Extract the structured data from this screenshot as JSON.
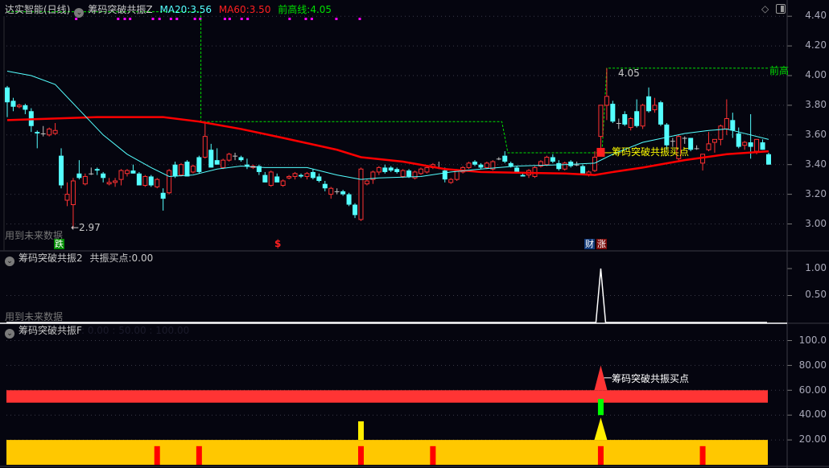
{
  "main_panel": {
    "stock_name": "达实智能(日线)",
    "indicator": "筹码突破共振Z",
    "ma20_label": "MA20:",
    "ma20_value": "3.56",
    "ma60_label": "MA60:",
    "ma60_value": "3.50",
    "prev_high_label": "前高线:",
    "prev_high_value": "4.05",
    "future_data_note": "用到未来数据",
    "low_annotation": "←2.97",
    "high_annotation": "4.05",
    "prev_high_tag": "前高",
    "buy_signal_label": "筹码突破共振买点",
    "markers": {
      "fall": "跌",
      "dollar": "$",
      "finance": "财",
      "rise": "涨"
    },
    "axis_labels": [
      "4.40",
      "4.20",
      "4.00",
      "3.80",
      "3.60",
      "3.40",
      "3.20",
      "3.00"
    ],
    "axis_values": [
      4.4,
      4.2,
      4.0,
      3.8,
      3.6,
      3.4,
      3.2,
      3.0
    ]
  },
  "panel2": {
    "indicator": "筹码突破共振2",
    "value_label": "共振买点:",
    "value": "0.00",
    "future_data_note": "用到未来数据",
    "axis_labels": [
      "1.00",
      "0.50"
    ],
    "spike_index": 99
  },
  "panel3": {
    "indicator": "筹码突破共振F",
    "hidden_values": ": 0.00 : 50.00 : 100.00",
    "buy_signal_label": "筹码突破共振买点",
    "axis_labels": [
      "100.0",
      "80.00",
      "60.00",
      "40.00",
      "20.00"
    ],
    "red_band": [
      50,
      60
    ],
    "yellow_band": [
      0,
      20
    ],
    "signal_index": 99,
    "red_spike_peak": 80,
    "yellow_spike_peak": 38,
    "green_bar": [
      40,
      53
    ],
    "yellow_bars": [
      {
        "i": 59,
        "v": 35
      }
    ],
    "red_bar_indices": [
      25,
      32,
      59,
      71,
      99,
      116
    ]
  },
  "colors": {
    "up": "#ff3232",
    "down": "#54ffff",
    "doji": "#c0c0c0",
    "ma20": "#54ffff",
    "ma60": "#ff0000",
    "prev_high": "#00e000",
    "dots": "#ff00ff",
    "signal_text": "#ffff00"
  },
  "chart_data": {
    "type": "candlestick",
    "ylim": [
      2.85,
      4.45
    ],
    "ohlc": [
      [
        3.92,
        3.93,
        3.72,
        3.82
      ],
      [
        3.83,
        3.85,
        3.76,
        3.79
      ],
      [
        3.79,
        3.81,
        3.78,
        3.8
      ],
      [
        3.8,
        3.81,
        3.74,
        3.77
      ],
      [
        3.76,
        3.78,
        3.62,
        3.66
      ],
      [
        3.62,
        3.63,
        3.51,
        3.61
      ],
      [
        3.61,
        3.66,
        3.59,
        3.61
      ],
      [
        3.6,
        3.65,
        3.59,
        3.64
      ],
      [
        3.61,
        3.68,
        3.6,
        3.63
      ],
      [
        3.46,
        3.51,
        3.24,
        3.26
      ],
      [
        3.16,
        3.28,
        3.12,
        3.2
      ],
      [
        3.13,
        3.31,
        2.97,
        3.29
      ],
      [
        3.34,
        3.43,
        3.3,
        3.31
      ],
      [
        3.27,
        3.34,
        3.26,
        3.32
      ],
      [
        3.34,
        3.38,
        3.33,
        3.34
      ],
      [
        3.37,
        3.38,
        3.33,
        3.36
      ],
      [
        3.34,
        3.35,
        3.28,
        3.31
      ],
      [
        3.27,
        3.31,
        3.26,
        3.28
      ],
      [
        3.28,
        3.31,
        3.25,
        3.29
      ],
      [
        3.3,
        3.37,
        3.26,
        3.36
      ],
      [
        3.34,
        3.37,
        3.32,
        3.36
      ],
      [
        3.36,
        3.4,
        3.34,
        3.34
      ],
      [
        3.34,
        3.35,
        3.26,
        3.26
      ],
      [
        3.26,
        3.33,
        3.25,
        3.32
      ],
      [
        3.32,
        3.33,
        3.25,
        3.26
      ],
      [
        3.25,
        3.31,
        3.24,
        3.3
      ],
      [
        3.21,
        3.24,
        3.09,
        3.17
      ],
      [
        3.21,
        3.37,
        3.2,
        3.36
      ],
      [
        3.4,
        3.42,
        3.31,
        3.32
      ],
      [
        3.33,
        3.41,
        3.32,
        3.4
      ],
      [
        3.42,
        3.43,
        3.32,
        3.32
      ],
      [
        3.35,
        3.4,
        3.34,
        3.39
      ],
      [
        3.45,
        3.46,
        3.34,
        3.35
      ],
      [
        3.45,
        3.68,
        3.44,
        3.59
      ],
      [
        3.5,
        3.54,
        3.38,
        3.38
      ],
      [
        3.43,
        3.51,
        3.4,
        3.4
      ],
      [
        3.38,
        3.44,
        3.37,
        3.43
      ],
      [
        3.43,
        3.48,
        3.42,
        3.47
      ],
      [
        3.46,
        3.48,
        3.43,
        3.46
      ],
      [
        3.45,
        3.46,
        3.42,
        3.43
      ],
      [
        3.4,
        3.44,
        3.37,
        3.39
      ],
      [
        3.38,
        3.4,
        3.37,
        3.39
      ],
      [
        3.39,
        3.4,
        3.33,
        3.35
      ],
      [
        3.33,
        3.35,
        3.28,
        3.28
      ],
      [
        3.26,
        3.36,
        3.25,
        3.35
      ],
      [
        3.32,
        3.34,
        3.28,
        3.28
      ],
      [
        3.26,
        3.3,
        3.25,
        3.29
      ],
      [
        3.31,
        3.33,
        3.3,
        3.32
      ],
      [
        3.32,
        3.35,
        3.3,
        3.34
      ],
      [
        3.33,
        3.34,
        3.31,
        3.32
      ],
      [
        3.32,
        3.35,
        3.3,
        3.34
      ],
      [
        3.35,
        3.37,
        3.3,
        3.31
      ],
      [
        3.32,
        3.34,
        3.28,
        3.29
      ],
      [
        3.27,
        3.29,
        3.22,
        3.24
      ],
      [
        3.2,
        3.25,
        3.17,
        3.24
      ],
      [
        3.22,
        3.24,
        3.2,
        3.22
      ],
      [
        3.22,
        3.23,
        3.19,
        3.2
      ],
      [
        3.2,
        3.21,
        3.12,
        3.13
      ],
      [
        3.13,
        3.14,
        3.04,
        3.06
      ],
      [
        3.03,
        3.38,
        3.02,
        3.37
      ],
      [
        3.27,
        3.3,
        3.26,
        3.29
      ],
      [
        3.3,
        3.36,
        3.27,
        3.35
      ],
      [
        3.35,
        3.39,
        3.33,
        3.38
      ],
      [
        3.38,
        3.4,
        3.34,
        3.35
      ],
      [
        3.38,
        3.39,
        3.35,
        3.36
      ],
      [
        3.37,
        3.38,
        3.34,
        3.35
      ],
      [
        3.32,
        3.37,
        3.31,
        3.36
      ],
      [
        3.36,
        3.37,
        3.31,
        3.32
      ],
      [
        3.31,
        3.36,
        3.3,
        3.35
      ],
      [
        3.34,
        3.38,
        3.33,
        3.37
      ],
      [
        3.35,
        3.39,
        3.34,
        3.38
      ],
      [
        3.38,
        3.41,
        3.37,
        3.4
      ],
      [
        3.38,
        3.42,
        3.37,
        3.38
      ],
      [
        3.36,
        3.38,
        3.28,
        3.3
      ],
      [
        3.28,
        3.31,
        3.27,
        3.3
      ],
      [
        3.3,
        3.37,
        3.29,
        3.36
      ],
      [
        3.35,
        3.39,
        3.34,
        3.38
      ],
      [
        3.38,
        3.42,
        3.37,
        3.41
      ],
      [
        3.42,
        3.43,
        3.39,
        3.4
      ],
      [
        3.4,
        3.41,
        3.37,
        3.38
      ],
      [
        3.38,
        3.42,
        3.37,
        3.41
      ],
      [
        3.37,
        3.43,
        3.36,
        3.42
      ],
      [
        3.44,
        3.45,
        3.43,
        3.44
      ],
      [
        3.46,
        3.49,
        3.41,
        3.42
      ],
      [
        3.41,
        3.42,
        3.38,
        3.39
      ],
      [
        3.38,
        3.39,
        3.34,
        3.35
      ],
      [
        3.33,
        3.34,
        3.32,
        3.32
      ],
      [
        3.33,
        3.37,
        3.31,
        3.36
      ],
      [
        3.32,
        3.39,
        3.31,
        3.38
      ],
      [
        3.39,
        3.43,
        3.38,
        3.42
      ],
      [
        3.4,
        3.46,
        3.39,
        3.45
      ],
      [
        3.45,
        3.47,
        3.41,
        3.42
      ],
      [
        3.41,
        3.43,
        3.36,
        3.37
      ],
      [
        3.37,
        3.42,
        3.36,
        3.41
      ],
      [
        3.42,
        3.43,
        3.38,
        3.39
      ],
      [
        3.4,
        3.42,
        3.39,
        3.4
      ],
      [
        3.39,
        3.4,
        3.33,
        3.34
      ],
      [
        3.33,
        3.36,
        3.32,
        3.35
      ],
      [
        3.36,
        3.49,
        3.35,
        3.45
      ],
      [
        3.59,
        3.8,
        3.46,
        3.8
      ],
      [
        3.8,
        4.05,
        3.7,
        3.86
      ],
      [
        3.81,
        3.83,
        3.68,
        3.69
      ],
      [
        3.68,
        3.71,
        3.64,
        3.68
      ],
      [
        3.74,
        3.76,
        3.66,
        3.67
      ],
      [
        3.65,
        3.72,
        3.63,
        3.71
      ],
      [
        3.76,
        3.84,
        3.65,
        3.66
      ],
      [
        3.66,
        3.81,
        3.64,
        3.8
      ],
      [
        3.86,
        3.92,
        3.75,
        3.76
      ],
      [
        3.77,
        3.85,
        3.75,
        3.8
      ],
      [
        3.82,
        3.83,
        3.66,
        3.67
      ],
      [
        3.67,
        3.68,
        3.5,
        3.53
      ],
      [
        3.56,
        3.58,
        3.52,
        3.56
      ],
      [
        3.44,
        3.6,
        3.43,
        3.59
      ],
      [
        3.58,
        3.59,
        3.54,
        3.58
      ],
      [
        3.58,
        3.58,
        3.49,
        3.5
      ],
      [
        3.51,
        3.53,
        3.5,
        3.51
      ],
      [
        3.41,
        3.47,
        3.36,
        3.47
      ],
      [
        3.5,
        3.62,
        3.49,
        3.54
      ],
      [
        3.55,
        3.57,
        3.48,
        3.57
      ],
      [
        3.57,
        3.67,
        3.53,
        3.66
      ],
      [
        3.64,
        3.84,
        3.6,
        3.71
      ],
      [
        3.7,
        3.75,
        3.58,
        3.63
      ],
      [
        3.61,
        3.65,
        3.51,
        3.52
      ],
      [
        3.53,
        3.56,
        3.5,
        3.55
      ],
      [
        3.55,
        3.74,
        3.44,
        3.52
      ],
      [
        3.49,
        3.57,
        3.47,
        3.57
      ],
      [
        3.55,
        3.57,
        3.5,
        3.5
      ],
      [
        3.47,
        3.48,
        3.4,
        3.4
      ]
    ],
    "ma20": [
      [
        0,
        4.03
      ],
      [
        4,
        4.0
      ],
      [
        8,
        3.94
      ],
      [
        12,
        3.77
      ],
      [
        16,
        3.6
      ],
      [
        20,
        3.47
      ],
      [
        24,
        3.38
      ],
      [
        27,
        3.32
      ],
      [
        31,
        3.33
      ],
      [
        35,
        3.37
      ],
      [
        39,
        3.39
      ],
      [
        43,
        3.38
      ],
      [
        50,
        3.38
      ],
      [
        55,
        3.33
      ],
      [
        59,
        3.3
      ],
      [
        62,
        3.31
      ],
      [
        69,
        3.32
      ],
      [
        74,
        3.35
      ],
      [
        79,
        3.37
      ],
      [
        85,
        3.39
      ],
      [
        93,
        3.4
      ],
      [
        98,
        3.41
      ],
      [
        101,
        3.47
      ],
      [
        106,
        3.55
      ],
      [
        113,
        3.61
      ],
      [
        117,
        3.63
      ],
      [
        120,
        3.64
      ],
      [
        124,
        3.6
      ],
      [
        127,
        3.57
      ]
    ],
    "ma60": [
      [
        0,
        3.7
      ],
      [
        15,
        3.72
      ],
      [
        26,
        3.72
      ],
      [
        32,
        3.69
      ],
      [
        39,
        3.64
      ],
      [
        46,
        3.58
      ],
      [
        55,
        3.5
      ],
      [
        59,
        3.45
      ],
      [
        66,
        3.42
      ],
      [
        73,
        3.37
      ],
      [
        79,
        3.35
      ],
      [
        93,
        3.34
      ],
      [
        98,
        3.33
      ],
      [
        101,
        3.35
      ],
      [
        106,
        3.38
      ],
      [
        113,
        3.43
      ],
      [
        120,
        3.47
      ],
      [
        127,
        3.49
      ]
    ],
    "prev_high": [
      [
        0,
        4.43
      ],
      [
        32.3,
        4.43
      ],
      [
        32.3,
        3.69
      ],
      [
        82.5,
        3.69
      ],
      [
        83.5,
        3.48
      ],
      [
        99.2,
        3.48
      ],
      [
        100,
        4.05
      ],
      [
        127,
        4.05
      ]
    ],
    "top_dot_indices": [
      11.5,
      18.5,
      19.6,
      20.5,
      24.3,
      25.4,
      27.3,
      28.3,
      31.3,
      32.2,
      36.3,
      37.1,
      39.1,
      40.1,
      47.1,
      49.8,
      50.8,
      54.9,
      58.8
    ],
    "buy_signal_index": 99
  }
}
